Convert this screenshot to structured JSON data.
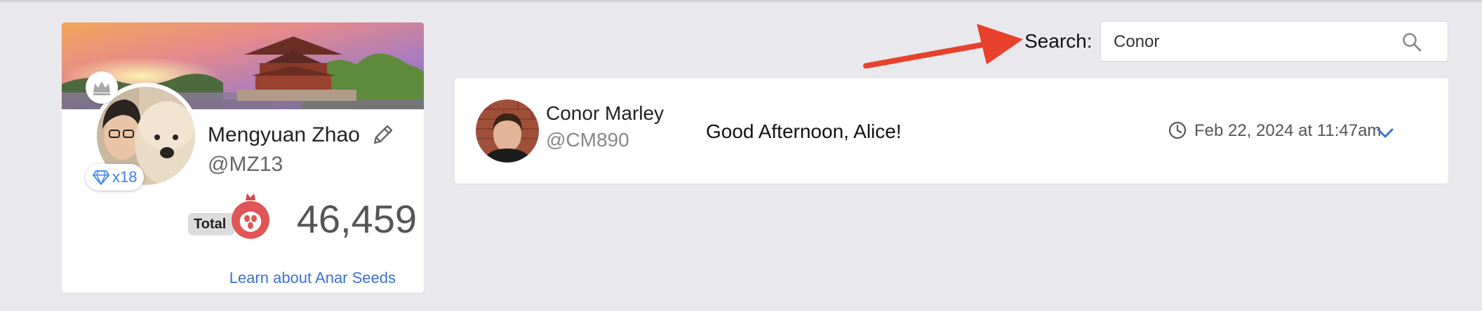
{
  "profile": {
    "name": "Mengyuan Zhao",
    "handle": "@MZ13",
    "tier_count": "x18",
    "total_label": "Total",
    "total_value": "46,459",
    "learn_link": "Learn about Anar Seeds"
  },
  "search": {
    "label": "Search:",
    "value": "Conor"
  },
  "message": {
    "sender_name": "Conor Marley",
    "sender_handle": "@CM890",
    "text": "Good Afternoon, Alice!",
    "timestamp": "Feb 22, 2024 at 11:47am"
  },
  "colors": {
    "background": "#e9e9ed",
    "link": "#3b6fd4",
    "arrow": "#e8412c",
    "seed": "#e05555",
    "chevron": "#3b6fd4"
  },
  "icons": {
    "crown": "crown-icon",
    "diamond": "diamond-icon",
    "edit": "pencil-icon",
    "seed": "pomegranate-icon",
    "search": "search-icon",
    "clock": "clock-icon",
    "expand": "chevron-down-icon",
    "pointer": "arrow-icon"
  }
}
